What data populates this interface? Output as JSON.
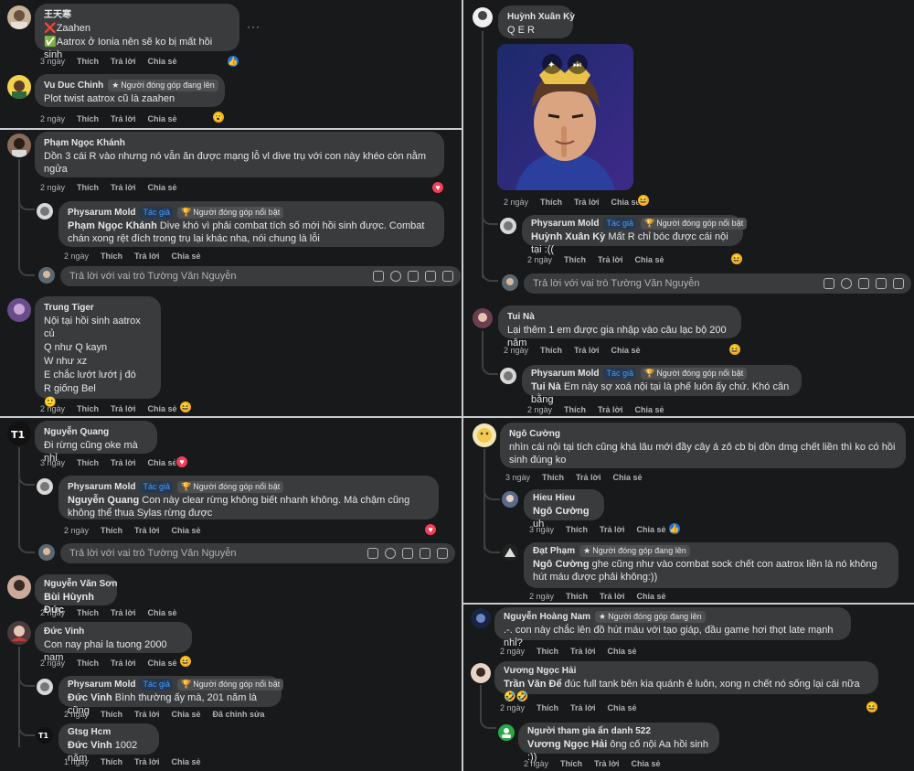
{
  "actions": {
    "like": "Thích",
    "reply": "Trả lời",
    "share": "Chia sẻ",
    "edited": "Đã chỉnh sửa"
  },
  "reply_placeholder": "Trả lời với vai trò Tường Văn Nguyễn",
  "tags": {
    "author": "Tác giả",
    "top_fan": "Người đóng góp nổi bật",
    "rising": "Người đóng góp đang lên"
  },
  "p1": {
    "c1": {
      "name": "王天寒",
      "l1": "Zaahen",
      "l2": "Aatrox ở Ionia nên sẽ ko bị mất hồi sinh",
      "time": "3 ngày",
      "more": "···"
    },
    "c2": {
      "name": "Vu Duc Chinh",
      "text": "Plot twist aatrox cũ là zaahen",
      "time": "2 ngày"
    }
  },
  "p2": {
    "c1": {
      "name": "Phạm Ngọc Khánh",
      "text": "Dồn 3 cái R vào nhưng nó vẫn ăn được mạng lỗ vl dive trụ với con này khéo còn nằm ngửa",
      "time": "2 ngày"
    },
    "r1": {
      "name": "Physarum Mold",
      "mention": "Phạm Ngọc Khánh",
      "text": "Dive khó vì phải combat tích số mới hồi sinh được. Combat chán xong rệt đích trong trụ lại khác nha, nói chung là lỗi",
      "time": "2 ngày"
    },
    "c2": {
      "name": "Trung Tiger",
      "lines": [
        "Nội tại hồi sinh aatrox củ",
        "Q như Q kayn",
        "W như xz",
        "E chắc lướt lướt j đó",
        "R giống Bel",
        "🙂"
      ],
      "time": "2 ngày"
    }
  },
  "p3": {
    "c1": {
      "name": "Huỳnh Xuân Kỳ",
      "text": "Q E R",
      "time": "2 ngày"
    },
    "r1": {
      "name": "Physarum Mold",
      "mention": "Huỳnh Xuân Kỳ",
      "text": "Mất R chỉ bóc được cái nội tại :((",
      "time": "2 ngày"
    },
    "c2": {
      "name": "Tui Nà",
      "text": "Lại thêm 1 em được gia nhập vào câu lạc bộ 200 năm",
      "time": "2 ngày"
    },
    "r2": {
      "name": "Physarum Mold",
      "mention": "Tui Nà",
      "text": "Em này sợ xoá nội tại là phế luôn ấy chứ. Khó cân bằng",
      "time": "2 ngày"
    }
  },
  "p4": {
    "c1": {
      "name": "Nguyễn Quang",
      "text": "Đi rừng cũng oke mà nhỉ",
      "time": "3 ngày"
    },
    "r1": {
      "name": "Physarum Mold",
      "mention": "Nguyễn Quang",
      "text": "Con này clear rừng không biết nhanh không. Mà chậm cũng không thể thua Sylas rừng được",
      "time": "2 ngày"
    },
    "c2": {
      "name": "Nguyễn Văn Sơn",
      "mention": "Bùi Hùynh Đức",
      "time": "2 ngày"
    },
    "c3": {
      "name": "Đức Vinh",
      "text": "Con nay phai la tuong 2000 nam",
      "time": "2 ngày"
    },
    "r2": {
      "name": "Physarum Mold",
      "mention": "Đức Vinh",
      "text": "Bình thường ấy mà, 201 năm là cũng",
      "time": "2 ngày"
    },
    "r3": {
      "name": "Gtsg Hcm",
      "mention": "Đức Vinh",
      "text": "1002 năm",
      "time": "1 ngày"
    }
  },
  "p5": {
    "c1": {
      "name": "Ngô Cường",
      "text": "nhìn cái nội tại tích cũng khá lâu mới đầy cây á zô cb bị dồn dmg chết liền thì ko có hồi sinh đúng ko",
      "time": "3 ngày"
    },
    "r1": {
      "name": "Hieu Hieu",
      "mention": "Ngô Cường",
      "text": "uh",
      "time": "3 ngày"
    },
    "r2": {
      "name": "Đạt Phạm",
      "mention": "Ngô Cường",
      "text": "ghe cũng như vào combat sock chết con aatrox liền là nó không hút máu được phải không:))",
      "time": "2 ngày"
    }
  },
  "p6": {
    "c1": {
      "name": "Nguyễn Hoàng Nam",
      "text": ".-. con này chắc lên đồ hút máu với tạo giáp, đầu game hơi thọt late mạnh nhỉ?",
      "time": "2 ngày"
    },
    "c2": {
      "name": "Vương Ngọc Hải",
      "mention": "Trần Văn Để",
      "text": "đúc full tank bên kia quánh ẻ luôn, xong n chết nó sống lại cái nữa 🤣🤣",
      "time": "2 ngày"
    },
    "r1": {
      "name": "Người tham gia ẩn danh 522",
      "mention": "Vương Ngọc Hải",
      "text": "ông cố nội Aa hồi sinh :))",
      "time": "2 ngày"
    }
  }
}
